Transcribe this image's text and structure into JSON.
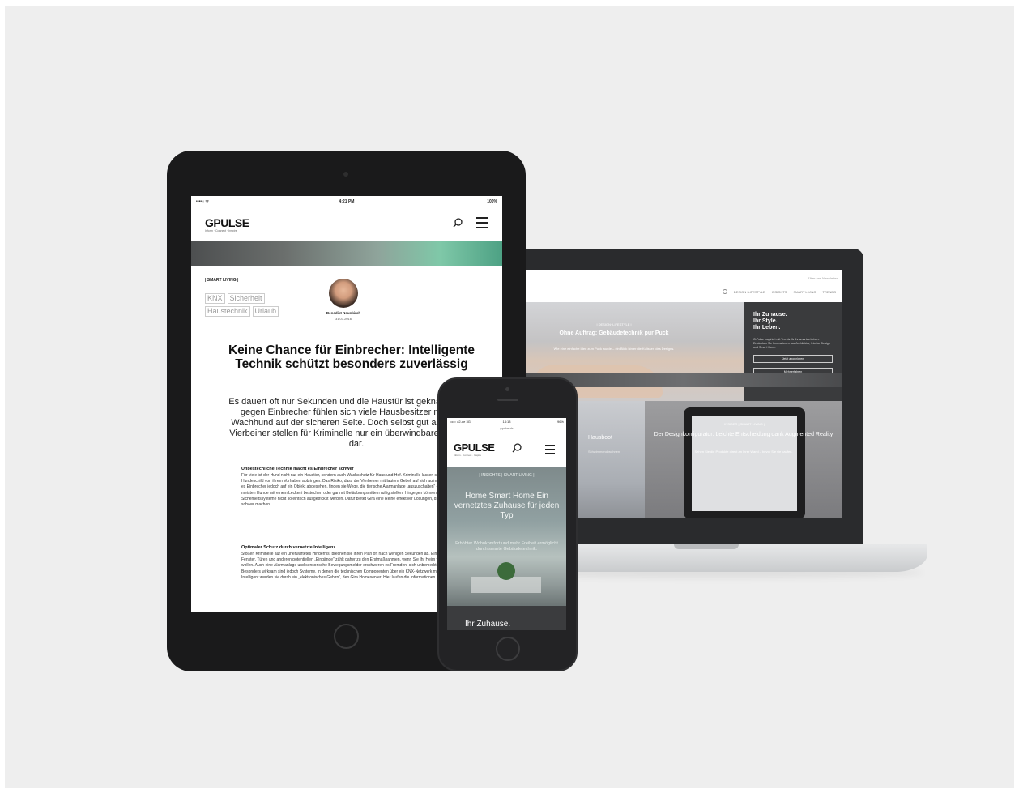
{
  "laptop": {
    "top_links": "Über uns   Newsletter",
    "nav": [
      "DESIGN+LIFESTYLE",
      "INSIGHTS",
      "SMART LIVING",
      "TRENDS"
    ],
    "hero": {
      "tag": "| DESIGN+LIFESTYLE |",
      "title": "Ohne Auftrag: Gebäudetechnik pur Puck",
      "text": "Wie eine einfache Idee zum Puck wurde – ein Blick hinter die Kulissen des Designs."
    },
    "side": {
      "title_line1": "Ihr Zuhause.",
      "title_line2": "Ihr Style.",
      "title_line3": "Ihr Leben.",
      "text": "G-Pulse inspiriert mit Trends für Ihr smartes Leben. Entdecken Sie Innovationen aus Architektur, Interior Design und Smart Home.",
      "button1": "Jetzt abonnieren",
      "button2": "Mehr erfahren"
    },
    "tile1": {
      "title": "Hausboot",
      "subtitle": "Schwimmend wohnen"
    },
    "tile2": {
      "tag": "| INSIDER | SMART LIVING |",
      "title": "Der Designkonfigurator: Leichte Entscheidung dank Augmented Reality",
      "text": "Sehen Sie die Produkte direkt an Ihrer Wand – bevor Sie sie kaufen."
    }
  },
  "tablet": {
    "status": {
      "left": "••••○ ᯤ",
      "time": "4:21 PM",
      "right": "100%"
    },
    "logo": "GPULSE",
    "logo_sub": "Inform · Connect · Inspire",
    "category": "| SMART LIVING |",
    "chips": [
      "KNX",
      "Sicherheit",
      "Haustechnik",
      "Urlaub"
    ],
    "author": "Benedikt Neunkirch",
    "date": "31.03.2016",
    "title": "Keine Chance für Einbrecher: Intelligente Technik schützt besonders zuverlässig",
    "lead": "Es dauert oft nur Sekunden und die Haustür ist geknackt. Schutz gegen Einbrecher fühlen sich viele Hausbesitzer mit einem Wachhund auf der sicheren Seite. Doch selbst gut ausgebildete Vierbeiner stellen für Kriminelle nur ein überwindbares Hindernis dar.",
    "h1": "Unbestechliche Technik macht es Einbrecher schwer",
    "p1": "Für viele ist der Hund nicht nur ein Haustier, sondern auch Wachschutz für Haus und Hof. Kriminelle lassen sich oft schon durch ein Hundeschild von ihrem Vorhaben abbringen. Das Risiko, dass der Vierbeiner mit lautem Gebell auf sich aufmerksam macht, ist groß. Haben es Einbrecher jedoch auf ein Objekt abgesehen, finden sie Wege, die tierische Alarmanlage „auszuschalten“ – Zu leicht lassen sich die meisten Hunde mit einem Leckerli bestechen oder gar mit Betäubungsmitteln ruhig stellen. Hingegen können intelligente Sicherheitssysteme nicht so einfach ausgetrickst werden. Dafür bietet Gira eine Reihe effektiver Lösungen, die es Einbrechern besonders schwer machen.",
    "h2": "Optimaler Schutz durch vernetzte Intelligenz",
    "p2": "Stoßen Kriminelle auf ein unerwartetes Hindernis, brechen sie ihren Plan oft nach wenigen Sekunden ab. Eine ausreichende Sicherung der Fenster, Türen und anderen potentiellen „Eingänge“ zählt daher zu den Erstmaßnahmen, wenn Sie Ihr Heim vor Einbrechern schützen wollen. Auch eine Alarmanlage und sensorische Bewegungsmelder erschweren es Fremden, sich unbemerkt Zutritt zu verschaffen. Besonders wirksam sind jedoch Systeme, in denen die technischen Komponenten über ein KNX-Netzwerk miteinander verbunden sind. Intelligent werden sie durch ein „elektronisches Gehirn“, den Gira Homeserver. Hier laufen die Informationen"
  },
  "phone": {
    "status": {
      "left": "••••○ o2-de  3G",
      "time": "14:13",
      "right": "96%"
    },
    "url": "g-pulse.de",
    "logo": "GPULSE",
    "logo_sub": "Inform · Connect · Inspire",
    "tag": "| INSIGHTS | SMART LIVING |",
    "title": "Home Smart Home Ein vernetztes Zuhause für jeden Typ",
    "text": "Erhöhter Wohnkomfort und mehr Freiheit ermöglicht durch smarte Gebäudetechnik.",
    "footer": "Ihr Zuhause."
  },
  "colors": {
    "background": "#eeeeee",
    "device_dark": "#1a1a1b",
    "accent_green": "#4da184"
  }
}
